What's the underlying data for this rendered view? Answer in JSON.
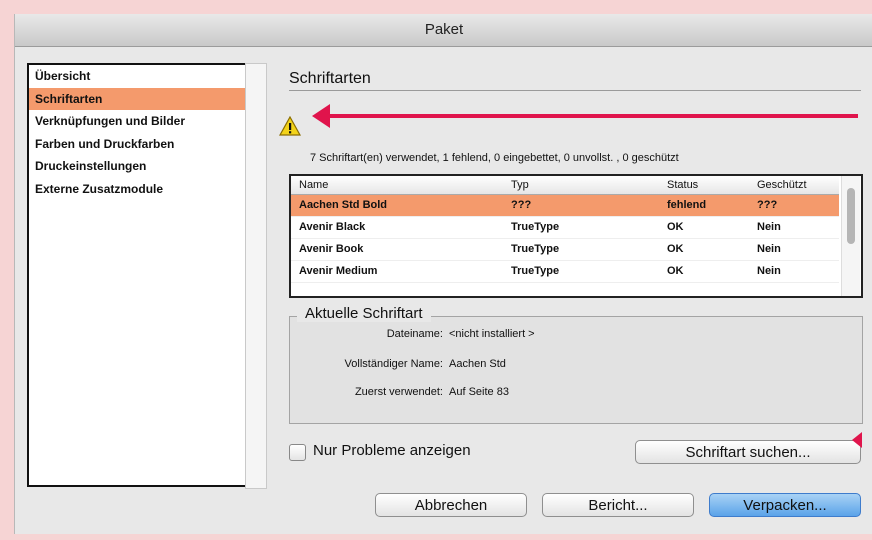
{
  "window": {
    "title": "Paket"
  },
  "sidebar": {
    "items": [
      {
        "label": "Übersicht"
      },
      {
        "label": "Schriftarten",
        "selected": true
      },
      {
        "label": "Verknüpfungen und Bilder"
      },
      {
        "label": "Farben und Druckfarben"
      },
      {
        "label": "Druckeinstellungen"
      },
      {
        "label": "Externe Zusatzmodule"
      }
    ]
  },
  "main": {
    "section_title": "Schriftarten",
    "summary": "7 Schriftart(en) verwendet, 1 fehlend, 0 eingebettet, 0 unvollst. , 0 geschützt",
    "table": {
      "headers": {
        "name": "Name",
        "type": "Typ",
        "status": "Status",
        "protected": "Geschützt"
      },
      "rows": [
        {
          "name": "Aachen Std Bold",
          "type": "???",
          "status": "fehlend",
          "protected": "???",
          "selected": true
        },
        {
          "name": "Avenir Black",
          "type": "TrueType",
          "status": "OK",
          "protected": "Nein"
        },
        {
          "name": "Avenir Book",
          "type": "TrueType",
          "status": "OK",
          "protected": "Nein"
        },
        {
          "name": "Avenir Medium",
          "type": "TrueType",
          "status": "OK",
          "protected": "Nein"
        }
      ]
    },
    "current_font": {
      "legend": "Aktuelle Schriftart",
      "filename_label": "Dateiname:",
      "filename_value": "<nicht installiert >",
      "fullname_label": "Vollständiger Name:",
      "fullname_value": "Aachen Std",
      "first_used_label": "Zuerst verwendet:",
      "first_used_value": "Auf Seite 83"
    },
    "only_problems_label": "Nur Probleme anzeigen",
    "find_font_label": "Schriftart suchen..."
  },
  "footer": {
    "cancel_label": "Abbrechen",
    "report_label": "Bericht...",
    "package_label": "Verpacken..."
  },
  "colors": {
    "accent": "#f49a6c",
    "annotation": "#e0144c",
    "primary": "#5aa3e9"
  }
}
